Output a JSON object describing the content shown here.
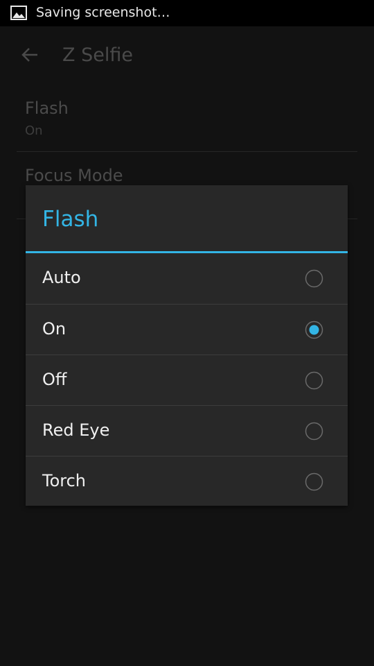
{
  "status_bar": {
    "text": "Saving screenshot…",
    "icon": "image-icon"
  },
  "app": {
    "title": "Z Selfie",
    "back_icon": "back-arrow-icon",
    "preferences": [
      {
        "title": "Flash",
        "summary": "On"
      },
      {
        "title": "Focus Mode",
        "summary": ""
      }
    ]
  },
  "dialog": {
    "title": "Flash",
    "options": [
      {
        "label": "Auto",
        "selected": false
      },
      {
        "label": "On",
        "selected": true
      },
      {
        "label": "Off",
        "selected": false
      },
      {
        "label": "Red Eye",
        "selected": false
      },
      {
        "label": "Torch",
        "selected": false
      }
    ]
  },
  "colors": {
    "accent": "#33b5e5",
    "dialog_bg": "#282828",
    "background": "#121212"
  }
}
